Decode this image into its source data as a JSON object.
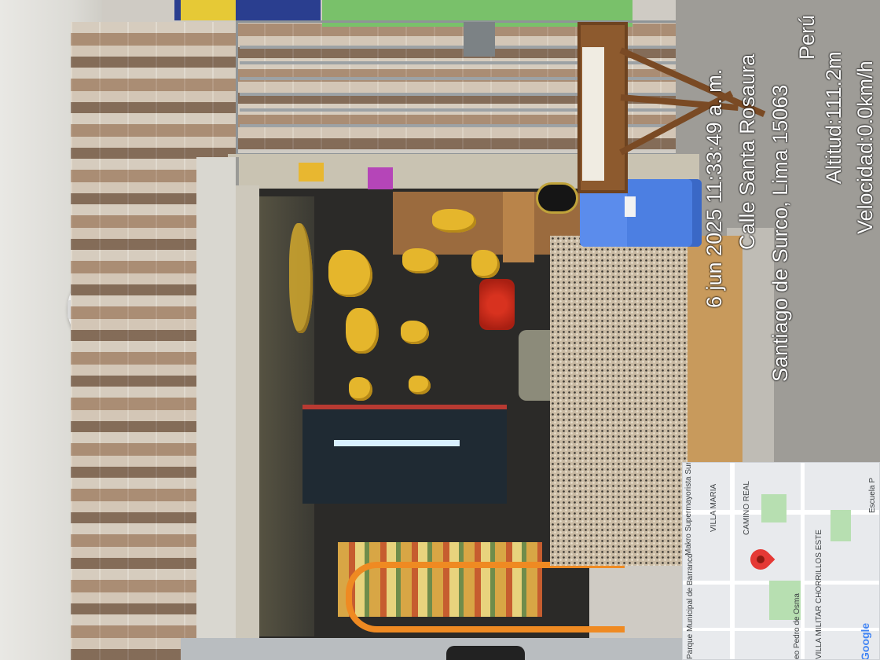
{
  "overlay": {
    "timestamp": "6 jun 2025 11:33:49 a. m.",
    "street": "Calle Santa Rosaura",
    "district": "Santiago de Surco, Lima 15063",
    "country": "Perú",
    "altitude": "Altitud:111.2m",
    "speed": "Velocidad:0.0km/h"
  },
  "map": {
    "labels": {
      "supermarket": "Makro Supermayorista Surco",
      "villa_maria": "VILLA MARIA",
      "camino_real": "CAMINO REAL",
      "park": "Parque Municipal de Barranco",
      "street": "eo Pedro de Osma",
      "villa_militar": "VILLA MILITAR CHORRILLOS ESTE",
      "school": "Escuela P",
      "logo": "Google"
    },
    "colors": {
      "pin": "#e53935",
      "park": "#b7dfb1",
      "road": "#ffffff",
      "base": "#e8eaed"
    }
  },
  "scene": {
    "shop_type": "fruit and grocery store",
    "orientation": "rotated 90° counter-clockwise",
    "colors": {
      "cooler": "#4c7fe2",
      "banana": "#e5b62c",
      "frame": "#ef8a22",
      "tile": "#b6a693"
    }
  }
}
